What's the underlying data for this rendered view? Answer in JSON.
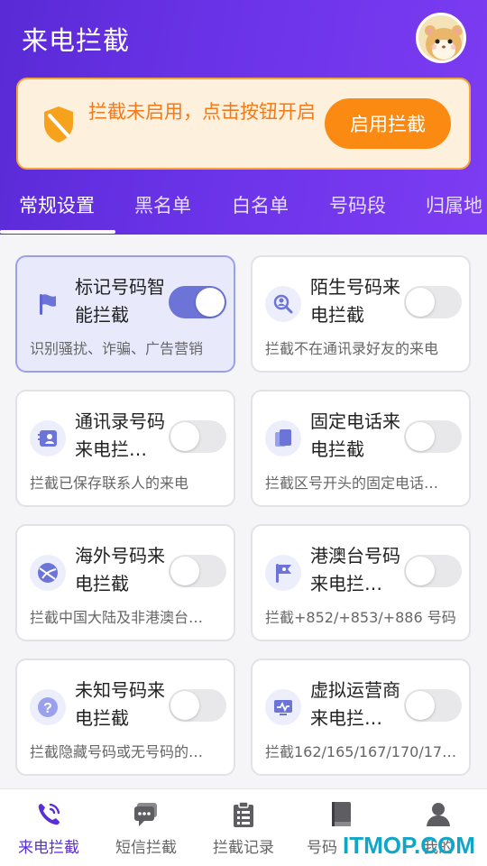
{
  "header": {
    "title": "来电拦截"
  },
  "banner": {
    "message": "拦截未启用，点击按钮开启",
    "button_label": "启用拦截"
  },
  "tabs": [
    {
      "label": "常规设置",
      "active": true
    },
    {
      "label": "黑名单"
    },
    {
      "label": "白名单"
    },
    {
      "label": "号码段"
    },
    {
      "label": "归属地"
    }
  ],
  "cards": [
    {
      "title": "标记号码智能拦截",
      "desc": "识别骚扰、诈骗、广告营销",
      "icon": "flag-icon",
      "enabled": true
    },
    {
      "title": "陌生号码来电拦截",
      "desc": "拦截不在通讯录好友的来电",
      "icon": "unknown-person-icon",
      "enabled": false
    },
    {
      "title": "通讯录号码来电拦…",
      "desc": "拦截已保存联系人的来电",
      "icon": "contacts-icon",
      "enabled": false
    },
    {
      "title": "固定电话来电拦截",
      "desc": "拦截区号开头的固定电话…",
      "icon": "landline-icon",
      "enabled": false
    },
    {
      "title": "海外号码来电拦截",
      "desc": "拦截中国大陆及非港澳台…",
      "icon": "globe-icon",
      "enabled": false
    },
    {
      "title": "港澳台号码来电拦…",
      "desc": "拦截+852/+853/+886 号码",
      "icon": "region-flag-icon",
      "enabled": false
    },
    {
      "title": "未知号码来电拦截",
      "desc": "拦截隐藏号码或无号码的…",
      "icon": "question-icon",
      "enabled": false
    },
    {
      "title": "虚拟运营商来电拦…",
      "desc": "拦截162/165/167/170/17…",
      "icon": "virtual-operator-icon",
      "enabled": false
    }
  ],
  "bottom_nav": [
    {
      "label": "来电拦截",
      "icon": "phone-call-icon",
      "active": true
    },
    {
      "label": "短信拦截",
      "icon": "message-icon"
    },
    {
      "label": "拦截记录",
      "icon": "clipboard-icon"
    },
    {
      "label": "号码",
      "icon": "book-icon"
    },
    {
      "label": "我的",
      "icon": "user-icon"
    }
  ],
  "watermark": "ITMOP.COM",
  "colors": {
    "header_start": "#5a2ad6",
    "header_end": "#7d3cf2",
    "accent_orange": "#fb8a13",
    "toggle_on": "#6c74d8"
  }
}
